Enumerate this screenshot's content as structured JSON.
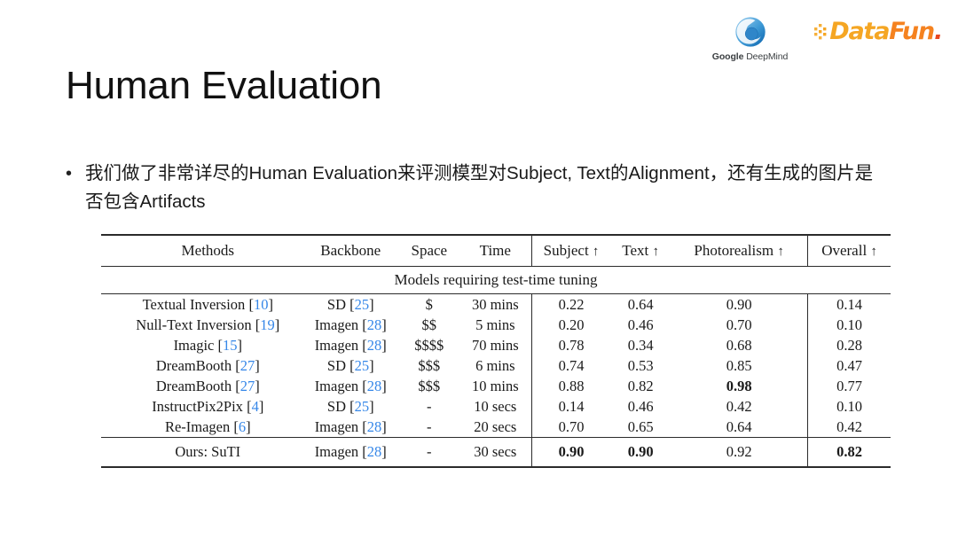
{
  "logos": {
    "google_deepmind": {
      "name": "google-deepmind-logo",
      "word_google": "Google",
      "word_deepmind": "DeepMind",
      "mark_color_dark": "#1a73c7",
      "mark_color_light": "#8ec4ea"
    },
    "datafun": {
      "name": "datafun-logo",
      "word_data": "Data",
      "word_fun": "Fun",
      "word_dot": ".",
      "color_data": "#f5a623",
      "color_fun": "#f5821f",
      "color_dot": "#e8471f"
    }
  },
  "slide": {
    "title": "Human Evaluation",
    "bullet_marker": "•",
    "bullet_text": "我们做了非常详尽的Human Evaluation来评测模型对Subject, Text的Alignment，还有生成的图片是否包含Artifacts"
  },
  "table": {
    "name": "human-evaluation-results-table",
    "citation_color": "#3687e8",
    "columns": [
      {
        "key": "method",
        "label": "Methods",
        "arrow": ""
      },
      {
        "key": "backbone",
        "label": "Backbone",
        "arrow": ""
      },
      {
        "key": "space",
        "label": "Space",
        "arrow": ""
      },
      {
        "key": "time",
        "label": "Time",
        "arrow": ""
      },
      {
        "key": "subject",
        "label": "Subject",
        "arrow": "↑"
      },
      {
        "key": "text",
        "label": "Text",
        "arrow": "↑"
      },
      {
        "key": "photo",
        "label": "Photorealism",
        "arrow": "↑"
      },
      {
        "key": "overall",
        "label": "Overall",
        "arrow": "↑"
      }
    ],
    "group_label": "Models requiring test-time tuning",
    "rows": [
      {
        "method": "Textual Inversion",
        "method_cite": "10",
        "backbone": "SD",
        "backbone_cite": "25",
        "space": "$",
        "time": "30 mins",
        "subject": "0.22",
        "text": "0.64",
        "photo": "0.90",
        "overall": "0.14",
        "bold": []
      },
      {
        "method": "Null-Text Inversion",
        "method_cite": "19",
        "backbone": "Imagen",
        "backbone_cite": "28",
        "space": "$$",
        "time": "5 mins",
        "subject": "0.20",
        "text": "0.46",
        "photo": "0.70",
        "overall": "0.10",
        "bold": []
      },
      {
        "method": "Imagic",
        "method_cite": "15",
        "backbone": "Imagen",
        "backbone_cite": "28",
        "space": "$$$$",
        "time": "70 mins",
        "subject": "0.78",
        "text": "0.34",
        "photo": "0.68",
        "overall": "0.28",
        "bold": []
      },
      {
        "method": "DreamBooth",
        "method_cite": "27",
        "backbone": "SD",
        "backbone_cite": "25",
        "space": "$$$",
        "time": "6 mins",
        "subject": "0.74",
        "text": "0.53",
        "photo": "0.85",
        "overall": "0.47",
        "bold": []
      },
      {
        "method": "DreamBooth",
        "method_cite": "27",
        "backbone": "Imagen",
        "backbone_cite": "28",
        "space": "$$$",
        "time": "10 mins",
        "subject": "0.88",
        "text": "0.82",
        "photo": "0.98",
        "overall": "0.77",
        "bold": [
          "photo"
        ]
      },
      {
        "method": "InstructPix2Pix",
        "method_cite": "4",
        "backbone": "SD",
        "backbone_cite": "25",
        "space": "-",
        "time": "10 secs",
        "subject": "0.14",
        "text": "0.46",
        "photo": "0.42",
        "overall": "0.10",
        "bold": []
      },
      {
        "method": "Re-Imagen",
        "method_cite": "6",
        "backbone": "Imagen",
        "backbone_cite": "28",
        "space": "-",
        "time": "20 secs",
        "subject": "0.70",
        "text": "0.65",
        "photo": "0.64",
        "overall": "0.42",
        "bold": []
      }
    ],
    "final_row": {
      "method": "Ours: SuTI",
      "method_cite": "",
      "backbone": "Imagen",
      "backbone_cite": "28",
      "space": "-",
      "time": "30 secs",
      "subject": "0.90",
      "text": "0.90",
      "photo": "0.92",
      "overall": "0.82",
      "bold": [
        "subject",
        "text",
        "overall"
      ]
    }
  }
}
